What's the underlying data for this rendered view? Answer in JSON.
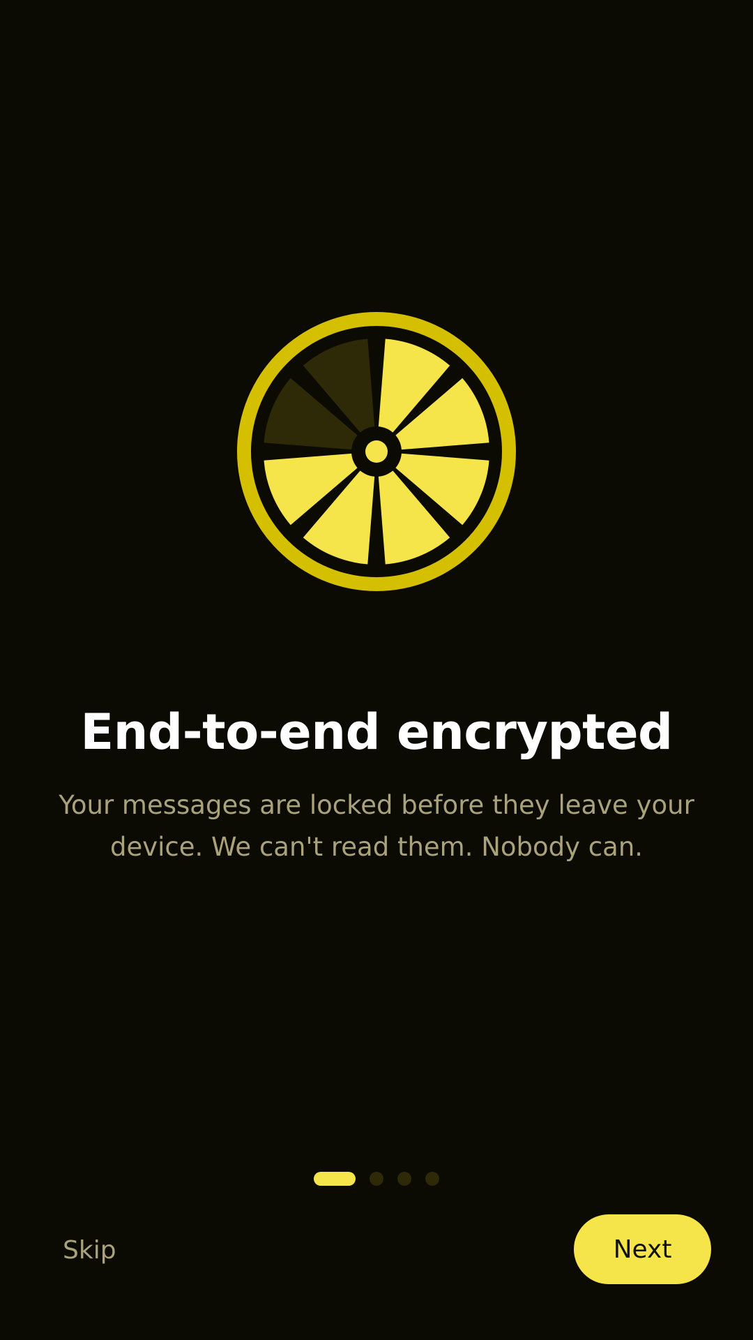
{
  "theme": {
    "background": "#0b0b04",
    "accent": "#f5e54a",
    "ring": "#d4c000",
    "dim_segment": "#2e2a08",
    "title_color": "#ffffff",
    "subtitle_color": "#aaa27a"
  },
  "hero": {
    "icon": "lemon-slice-lock-icon",
    "segments_total": 8,
    "segments_lit": 6
  },
  "content": {
    "title": "End-to-end encrypted",
    "subtitle": "Your messages are locked before they leave your device. We can't read them. Nobody can."
  },
  "pager": {
    "total": 4,
    "current": 1
  },
  "actions": {
    "skip_label": "Skip",
    "next_label": "Next"
  }
}
